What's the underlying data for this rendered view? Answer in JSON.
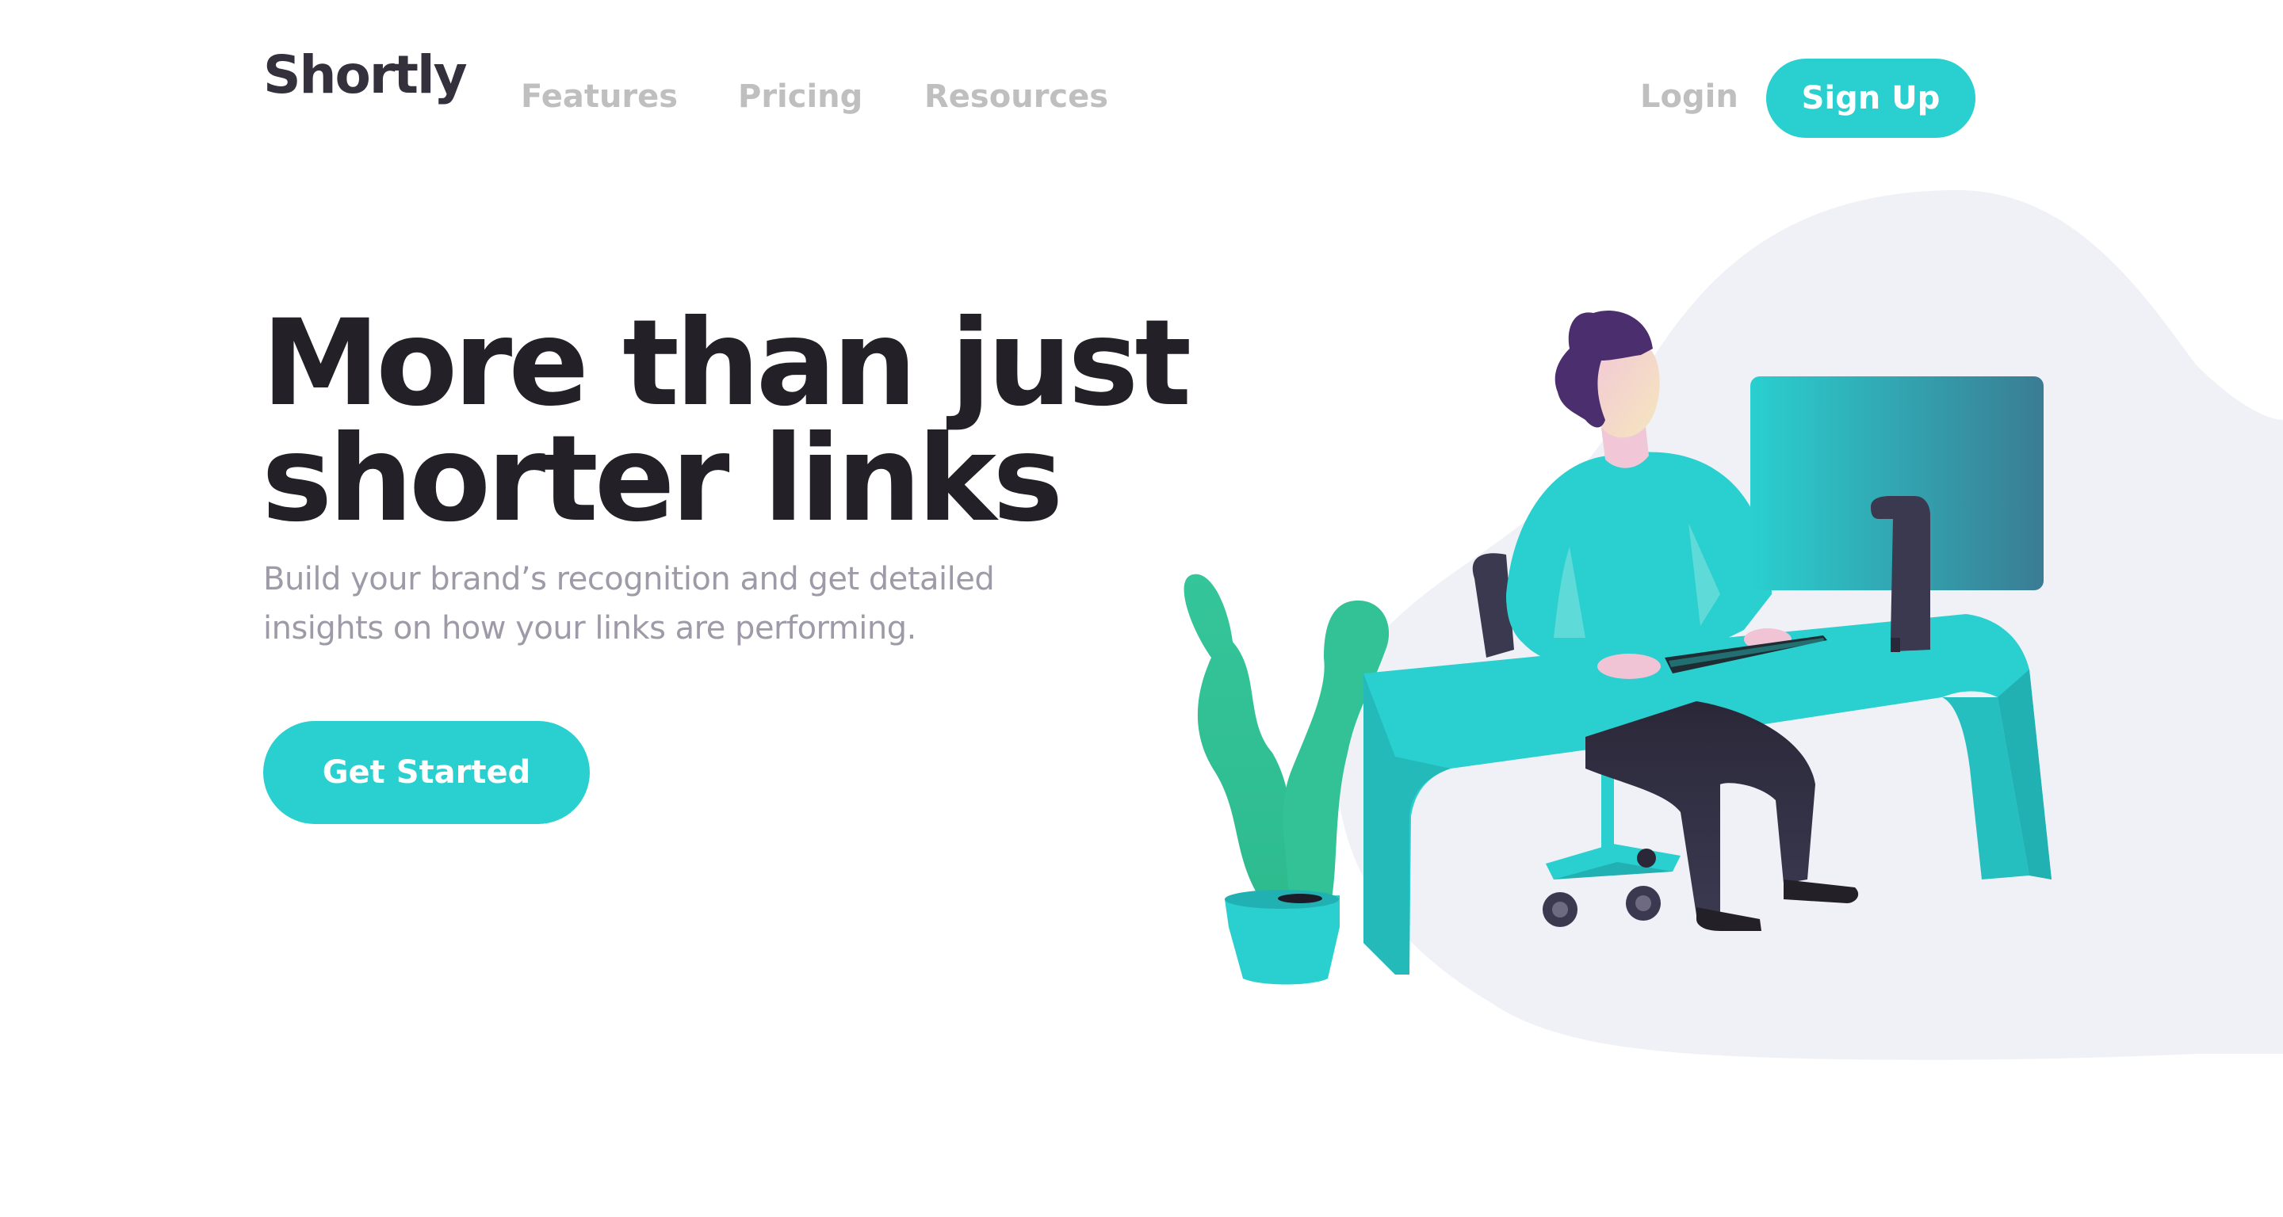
{
  "header": {
    "logo": "Shortly",
    "nav": {
      "features": "Features",
      "pricing": "Pricing",
      "resources": "Resources"
    },
    "login": "Login",
    "signup": "Sign Up"
  },
  "hero": {
    "title_line1": "More than just",
    "title_line2": "shorter links",
    "subtitle": "Build your brand’s recognition and get detailed insights on how your links are performing.",
    "cta": "Get Started"
  },
  "colors": {
    "primary": "#2acfcf",
    "dark_text": "#232127",
    "muted_text": "#9e9aa7",
    "nav_text": "#bfbfbf",
    "blob": "#f0f1f6"
  },
  "illustration": {
    "icon": "person-working-illustration"
  }
}
